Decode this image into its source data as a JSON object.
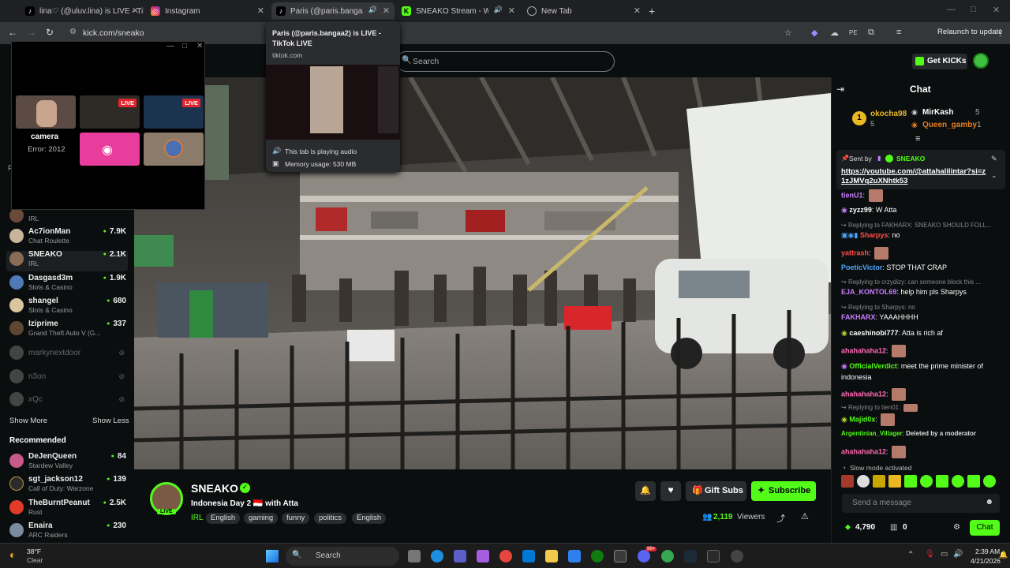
{
  "tabs": [
    {
      "title": "lina♡ (@uluv.lina) is LIVE - TikTok",
      "icon": "tiktok-icon"
    },
    {
      "title": "Instagram",
      "icon": "instagram-icon"
    },
    {
      "title": "Paris (@paris.bangaa2) is LIVE - TikTok",
      "icon": "tiktok-icon"
    },
    {
      "title": "SNEAKO Stream - Watch Live",
      "icon": "kick-icon"
    },
    {
      "title": "New Tab",
      "icon": "chrome-icon"
    }
  ],
  "browser": {
    "url": "kick.com/sneako",
    "relaunch_label": "Relaunch to update"
  },
  "hover_card": {
    "title": "Paris (@paris.bangaa2) is LIVE - TikTok LIVE",
    "domain": "tiktok.com",
    "audio_text": "This tab is playing audio",
    "memory_text": "Memory usage: 530 MB"
  },
  "popup": {
    "camera_label": "camera",
    "error_text": "Error: 2012",
    "live_badge": "LIVE"
  },
  "header": {
    "search_placeholder": "Search",
    "get_kicks_label": "Get KICKs"
  },
  "sidebar": {
    "following": [
      {
        "name": "",
        "category": "IRL",
        "viewers": ""
      },
      {
        "name": "Ac7ionMan",
        "category": "Chat Roulette",
        "viewers": "7.9K"
      },
      {
        "name": "SNEAKO",
        "category": "IRL",
        "viewers": "2.1K"
      },
      {
        "name": "Dasgasd3m",
        "category": "Slots & Casino",
        "viewers": "1.9K"
      },
      {
        "name": "shangel",
        "category": "Slots & Casino",
        "viewers": "680"
      },
      {
        "name": "Iziprime",
        "category": "Grand Theft Auto V (G...",
        "viewers": "337"
      }
    ],
    "offline": [
      "markynextdoor",
      "n3on",
      "xQc"
    ],
    "show_more": "Show More",
    "show_less": "Show Less",
    "recommended_title": "Recommended",
    "recommended": [
      {
        "name": "DeJenQueen",
        "category": "Stardew Valley",
        "viewers": "84"
      },
      {
        "name": "sgt_jackson12",
        "category": "Call of Duty: Warzone",
        "viewers": "139"
      },
      {
        "name": "TheBurntPeanut",
        "category": "Rust",
        "viewers": "2.5K"
      },
      {
        "name": "Enaira",
        "category": "ARC Raiders",
        "viewers": "230"
      }
    ]
  },
  "channel": {
    "name": "SNEAKO",
    "title": "Indonesia Day 2 🇮🇩 with Atta",
    "category": "IRL",
    "tags": [
      "English",
      "gaming",
      "funny",
      "politics",
      "English"
    ],
    "live_badge": "LIVE",
    "gift_subs": "Gift Subs",
    "subscribe": "Subscribe",
    "viewers": "2,119",
    "viewers_label": "Viewers"
  },
  "chat": {
    "title": "Chat",
    "leaderboard": [
      {
        "rank": "1",
        "user": "okocha98",
        "count": "5"
      },
      {
        "user": "MirKash",
        "count": "5"
      },
      {
        "user": "Queen_gamby",
        "count": "1"
      }
    ],
    "pinned": {
      "sent_by_label": "Sent by",
      "sender": "SNEAKO",
      "link": "https://youtube.com/@attahalilintar?si=z1zJMVq2uXNhtk53"
    },
    "messages": [
      {
        "type": "msg",
        "user": "tienU1",
        "text": "",
        "color": "#c77dff"
      },
      {
        "type": "msg",
        "user": "zyzz99",
        "text": " W Atta",
        "color": "#ffffff"
      },
      {
        "type": "reply",
        "text": "Replying to FAKHARX: SNEAKO SHOULD FOLL..."
      },
      {
        "type": "msg",
        "user": "Sharpys",
        "text": " no",
        "color": "#ff4d4d"
      },
      {
        "type": "msg",
        "user": "yattrash",
        "text": "",
        "color": "#ff4d4d"
      },
      {
        "type": "msg",
        "user": "PoeticVictor",
        "text": " STOP THAT CRAP",
        "color": "#4da6ff"
      },
      {
        "type": "reply",
        "text": "Replying to crzydizy: can someone block this ..."
      },
      {
        "type": "msg",
        "user": "EJA_KONTOL69",
        "text": " help him pls Sharpys",
        "color": "#c77dff"
      },
      {
        "type": "reply",
        "text": "Replying to Sharpys: no"
      },
      {
        "type": "msg",
        "user": "FAKHARX",
        "text": " YAAAHHHH",
        "color": "#c77dff"
      },
      {
        "type": "msg",
        "user": "caeshinobi777",
        "text": " Atta is rich af",
        "color": "#ffffff"
      },
      {
        "type": "msg",
        "user": "ahahahaha12",
        "text": "",
        "color": "#ff69b4"
      },
      {
        "type": "msg",
        "user": "OfficialVerdict",
        "text": " meet the prime minister of",
        "color": "#53fc18"
      },
      {
        "type": "cont",
        "text": "indonesia"
      },
      {
        "type": "msg",
        "user": "ahahahaha12",
        "text": "",
        "color": "#ff69b4"
      },
      {
        "type": "reply",
        "text": "Replying to tien01:"
      },
      {
        "type": "msg",
        "user": "Majid0x",
        "text": "",
        "color": "#53fc18"
      },
      {
        "type": "msg",
        "user": "Argentinian_Villager",
        "text": " Deleted by a moderator",
        "color": "#53fc18"
      },
      {
        "type": "msg",
        "user": "ahahahaha12",
        "text": "",
        "color": "#ff69b4"
      }
    ],
    "slow_mode": "Slow mode activated",
    "placeholder": "Send a message",
    "points": "4,790",
    "gifts": "0",
    "chat_button": "Chat"
  },
  "taskbar": {
    "weather_temp": "38°F",
    "weather_desc": "Clear",
    "search_label": "Search",
    "time": "2:39 AM",
    "date": "4/21/2026",
    "notif_badge": "99+"
  }
}
